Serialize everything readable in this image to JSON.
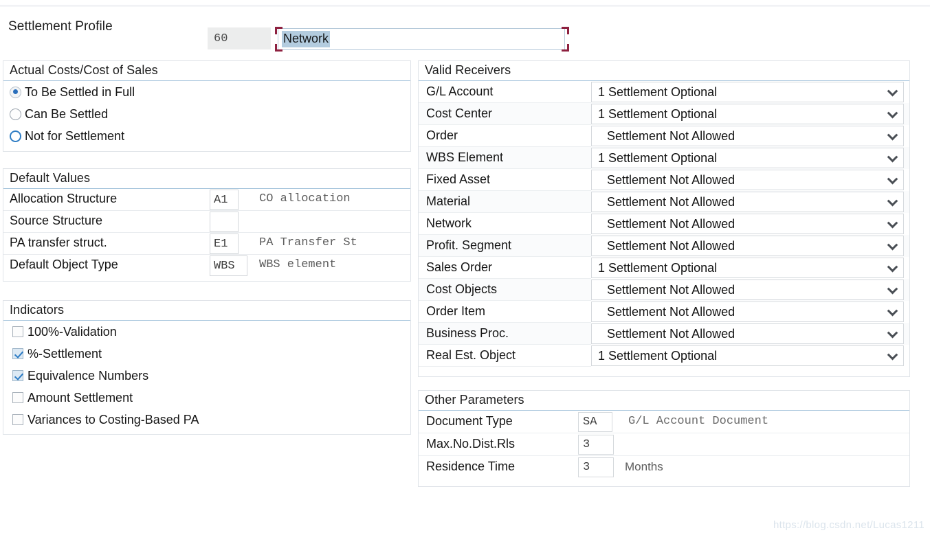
{
  "header": {
    "label": "Settlement Profile",
    "key": "60",
    "description": "Network"
  },
  "actual_costs": {
    "title": "Actual Costs/Cost of Sales",
    "options": [
      {
        "label": "To Be Settled in Full",
        "state": "checked"
      },
      {
        "label": "Can Be Settled",
        "state": "unchecked"
      },
      {
        "label": "Not for Settlement",
        "state": "focused"
      }
    ]
  },
  "default_values": {
    "title": "Default Values",
    "rows": [
      {
        "label": "Allocation Structure",
        "value": "A1",
        "description": "CO allocation "
      },
      {
        "label": "Source Structure",
        "value": "",
        "description": ""
      },
      {
        "label": "PA transfer struct.",
        "value": "E1",
        "description": "PA Transfer St"
      },
      {
        "label": "Default Object Type",
        "value": "WBS",
        "description": "WBS element"
      }
    ]
  },
  "indicators": {
    "title": "Indicators",
    "items": [
      {
        "label": "100%-Validation",
        "checked": false
      },
      {
        "label": "%-Settlement",
        "checked": true
      },
      {
        "label": "Equivalence Numbers",
        "checked": true
      },
      {
        "label": "Amount Settlement",
        "checked": false
      },
      {
        "label": "Variances to Costing-Based PA",
        "checked": false
      }
    ]
  },
  "valid_receivers": {
    "title": "Valid Receivers",
    "rows": [
      {
        "name": "G/L Account",
        "value": "1 Settlement Optional"
      },
      {
        "name": "Cost Center",
        "value": "1 Settlement Optional"
      },
      {
        "name": "Order",
        "value": "Settlement Not Allowed"
      },
      {
        "name": "WBS Element",
        "value": "1 Settlement Optional"
      },
      {
        "name": "Fixed Asset",
        "value": "Settlement Not Allowed"
      },
      {
        "name": "Material",
        "value": "Settlement Not Allowed"
      },
      {
        "name": "Network",
        "value": "Settlement Not Allowed"
      },
      {
        "name": "Profit. Segment",
        "value": "Settlement Not Allowed"
      },
      {
        "name": "Sales Order",
        "value": "1 Settlement Optional"
      },
      {
        "name": "Cost Objects",
        "value": "Settlement Not Allowed"
      },
      {
        "name": "Order Item",
        "value": "Settlement Not Allowed"
      },
      {
        "name": "Business Proc.",
        "value": "Settlement Not Allowed"
      },
      {
        "name": "Real Est. Object",
        "value": "1 Settlement Optional"
      }
    ]
  },
  "other_parameters": {
    "title": "Other Parameters",
    "rows": [
      {
        "label": "Document Type",
        "value": "SA",
        "suffix": "G/L Account Document",
        "suffix_mono": true
      },
      {
        "label": "Max.No.Dist.Rls",
        "value": "3",
        "suffix": "",
        "suffix_mono": false
      },
      {
        "label": "Residence Time",
        "value": "3",
        "suffix": "Months",
        "suffix_mono": false
      }
    ]
  },
  "watermark": "https://blog.csdn.net/Lucas1211"
}
